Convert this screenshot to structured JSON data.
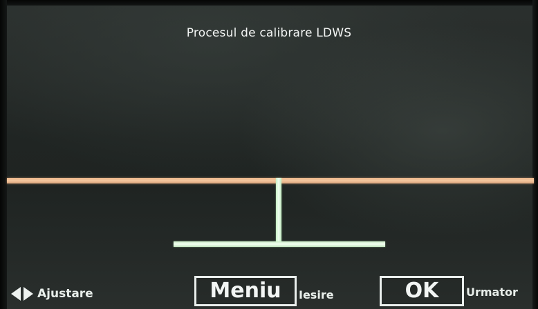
{
  "screen": {
    "title": "Procesul de calibrare LDWS"
  },
  "calibration": {
    "horizon_line_color": "#f0c096",
    "marker_color": "#e8fbe6"
  },
  "controls": {
    "adjust_icon": "left-right-arrows-icon",
    "adjust_label": "Ajustare",
    "menu_label": "Meniu",
    "exit_label": "Iesire",
    "ok_label": "OK",
    "next_label": "Urmator"
  }
}
